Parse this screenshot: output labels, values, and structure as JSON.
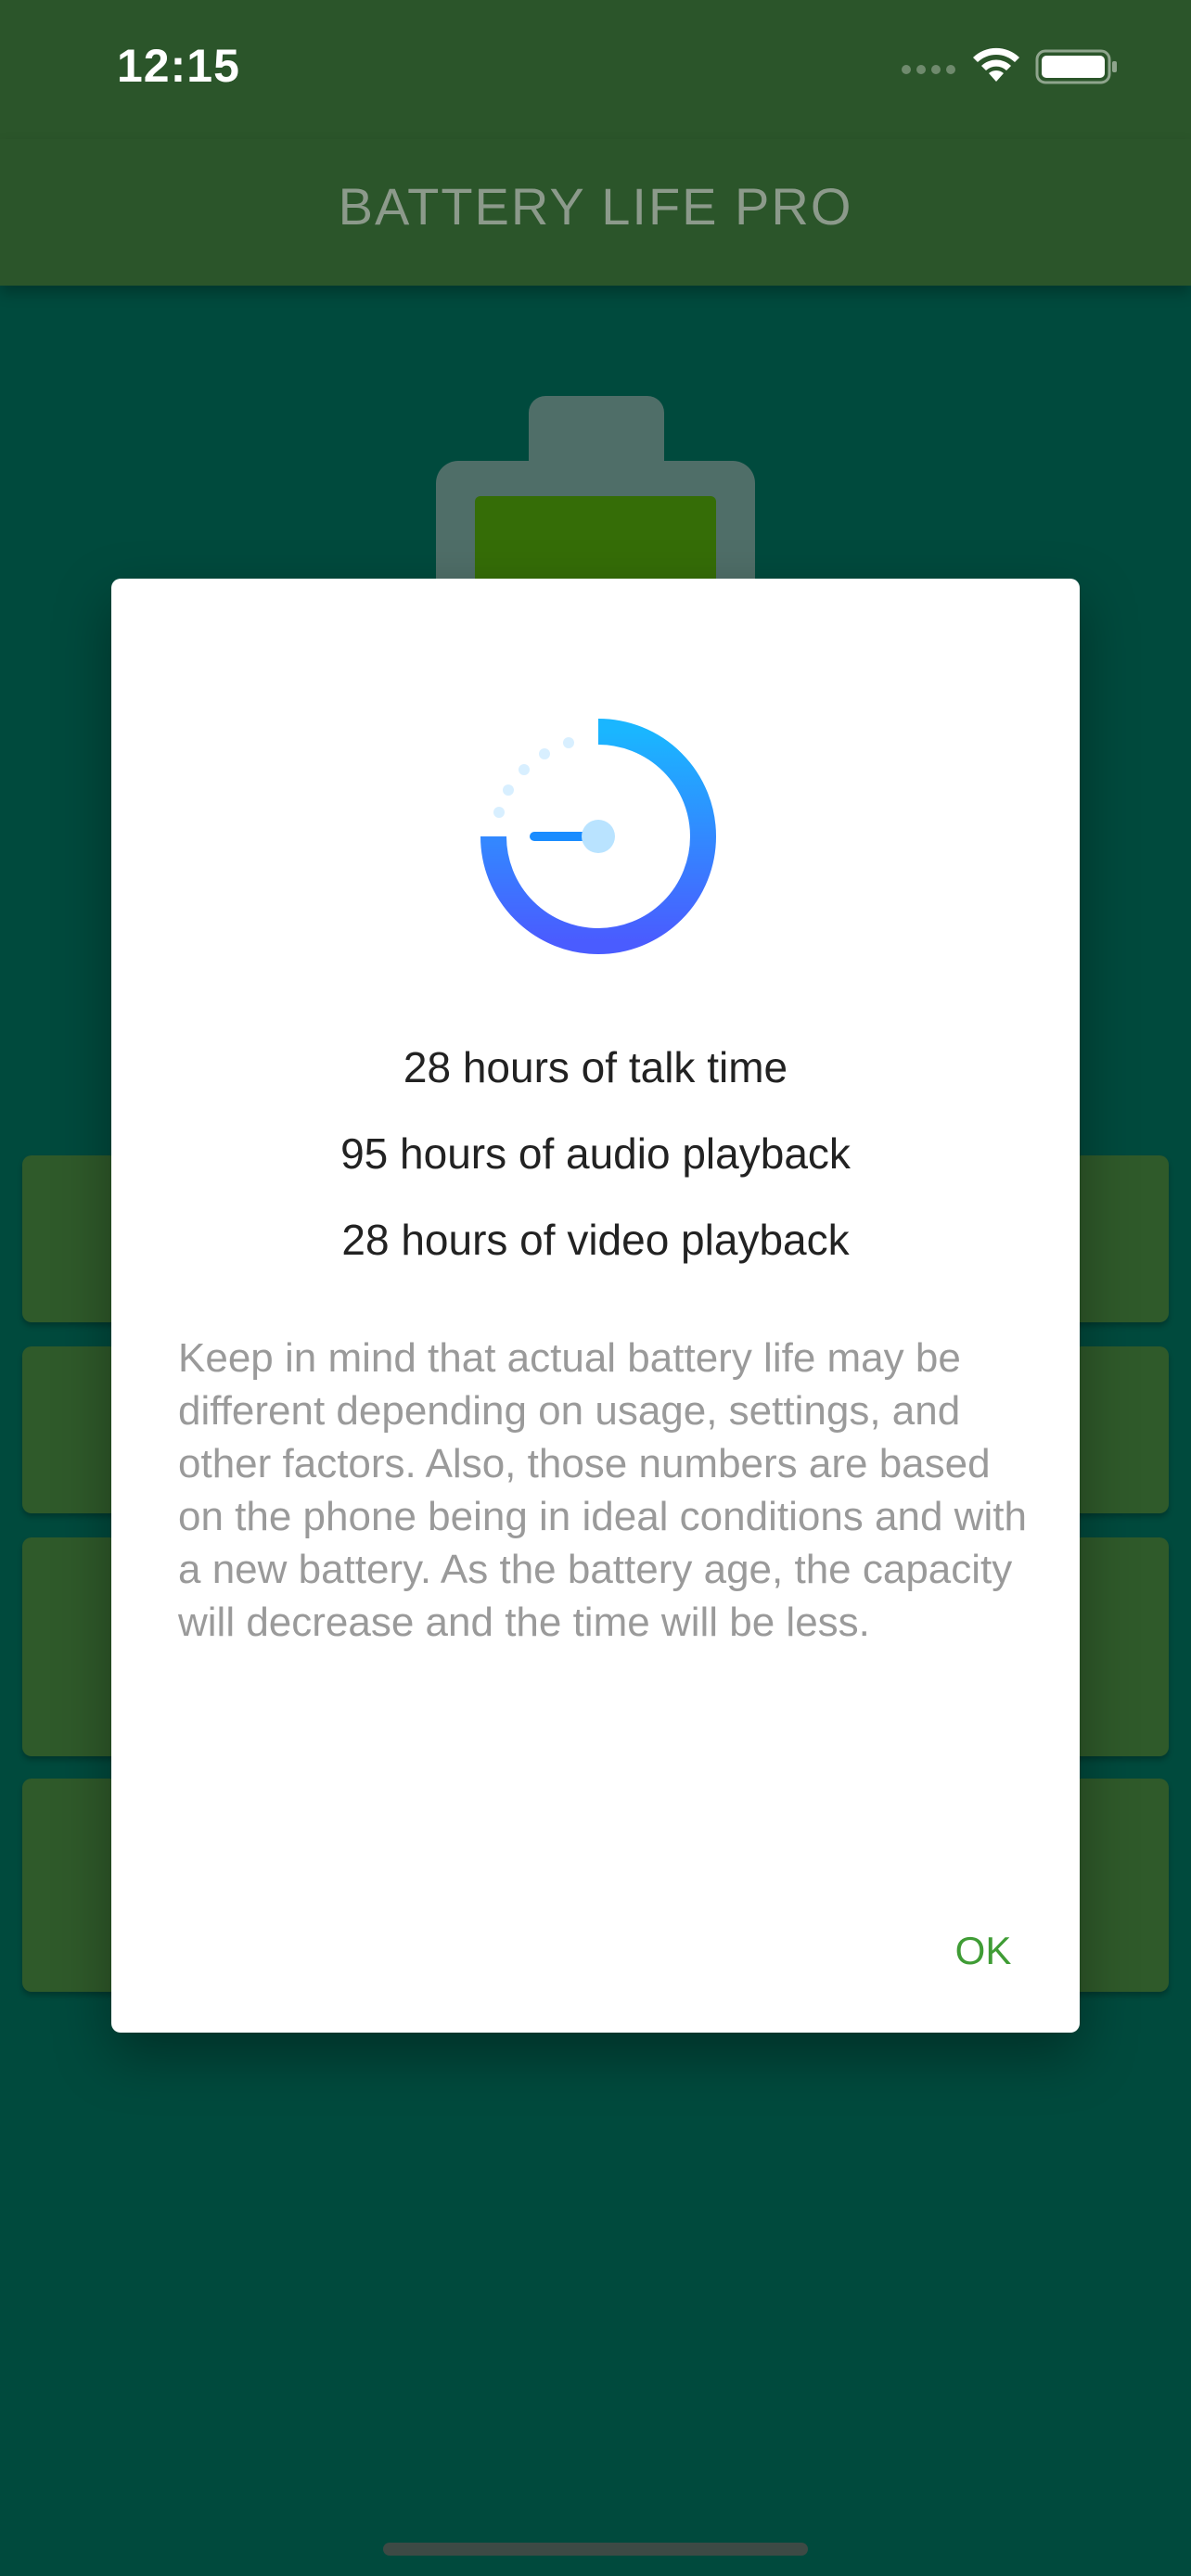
{
  "status_bar": {
    "time": "12:15",
    "signal_icon": "cellular-signal-icon",
    "wifi_icon": "wifi-icon",
    "battery_icon": "battery-full-icon"
  },
  "app_bar": {
    "title": "BATTERY LIFE PRO"
  },
  "dialog": {
    "icon": "timer-gauge-icon",
    "stats": [
      "28 hours of talk time",
      "95 hours of audio playback",
      "28 hours of video playback"
    ],
    "note": "Keep in mind that actual battery life may be different depending on usage, settings, and other factors. Also, those numbers are based on the phone being in ideal conditions and with a new battery. As the battery age, the capacity will decrease and the time will be less.",
    "ok_label": "OK"
  },
  "colors": {
    "bar": "#2b552a",
    "background": "#004a3d",
    "accent": "#3f9c35",
    "icon_gradient_start": "#1ab6ff",
    "icon_gradient_end": "#4a5cff"
  }
}
